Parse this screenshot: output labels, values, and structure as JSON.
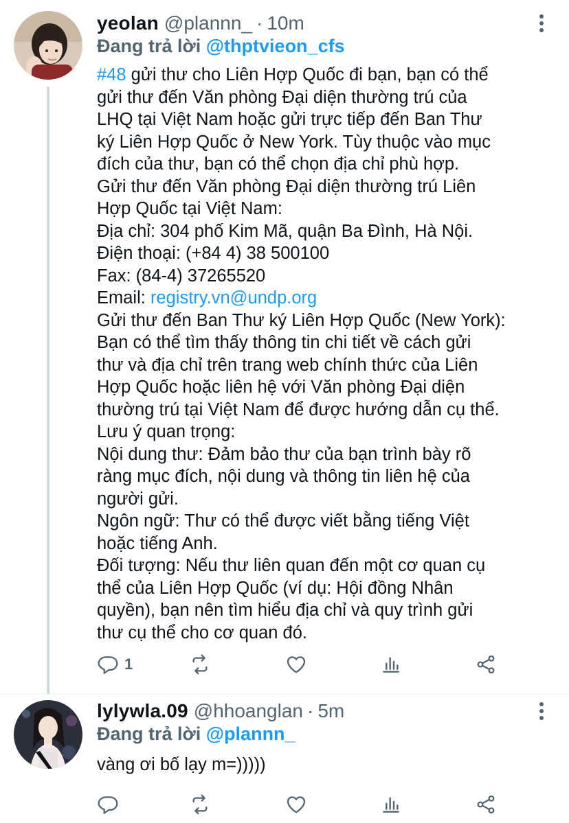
{
  "tweets": [
    {
      "name": "yeolan",
      "handle": "@plannn_",
      "separator": "·",
      "time": "10m",
      "reply_prefix": "Đang trả lời",
      "reply_handle": "@thptvieon_cfs",
      "hashtag": "#48",
      "first_line_rest": " gửi thư cho Liên Hợp Quốc đi bạn, bạn có thể",
      "lines": [
        "gửi thư đến Văn phòng Đại diện thường trú của",
        "LHQ tại Việt Nam hoặc gửi trực tiếp đến Ban Thư",
        "ký Liên Hợp Quốc ở New York. Tùy thuộc vào mục",
        "đích của thư, bạn có thể chọn địa chỉ phù hợp.",
        "Gửi thư đến Văn phòng Đại diện thường trú Liên",
        "Hợp Quốc tại Việt Nam:",
        "Địa chỉ: 304 phố Kim Mã, quận Ba Đình, Hà Nội.",
        "Điện thoại: (+84 4) 38 500100",
        "Fax: (84-4) 37265520"
      ],
      "email_label": "Email: ",
      "email_link": "registry.vn@undp.org",
      "lines_after": [
        "Gửi thư đến Ban Thư ký Liên Hợp Quốc (New York):",
        "Bạn có thể tìm thấy thông tin chi tiết về cách gửi",
        "thư và địa chỉ trên trang web chính thức của Liên",
        "Hợp Quốc hoặc liên hệ với Văn phòng Đại diện",
        "thường trú tại Việt Nam để được hướng dẫn cụ thể.",
        "Lưu ý quan trọng:",
        "Nội dung thư: Đảm bảo thư của bạn trình bày rõ",
        "ràng mục đích, nội dung và thông tin liên hệ của",
        "người gửi.",
        "Ngôn ngữ: Thư có thể được viết bằng tiếng Việt",
        "hoặc tiếng Anh.",
        "Đối tượng: Nếu thư liên quan đến một cơ quan cụ",
        "thể của Liên Hợp Quốc (ví dụ: Hội đồng Nhân",
        "quyền), bạn nên tìm hiểu địa chỉ và quy trình gửi",
        "thư cụ thể cho cơ quan đó."
      ],
      "reply_count": "1",
      "avatar_icon": "profile-photo-yeolan"
    },
    {
      "name": "lylywla.09",
      "handle": "@hhoanglan",
      "separator": "·",
      "time": "5m",
      "reply_prefix": "Đang trả lời",
      "reply_handle": "@plannn_",
      "text": "vàng ơi bố lạy m=)))))",
      "reply_count": "",
      "avatar_icon": "profile-photo-lylywla"
    }
  ],
  "colors": {
    "link": "#1d9bf0",
    "secondary_text": "#536471",
    "primary_text": "#0f1419",
    "thread_line": "#cfd9de"
  },
  "icons": [
    "reply-icon",
    "retweet-icon",
    "like-icon",
    "views-icon",
    "share-icon",
    "more-icon"
  ]
}
